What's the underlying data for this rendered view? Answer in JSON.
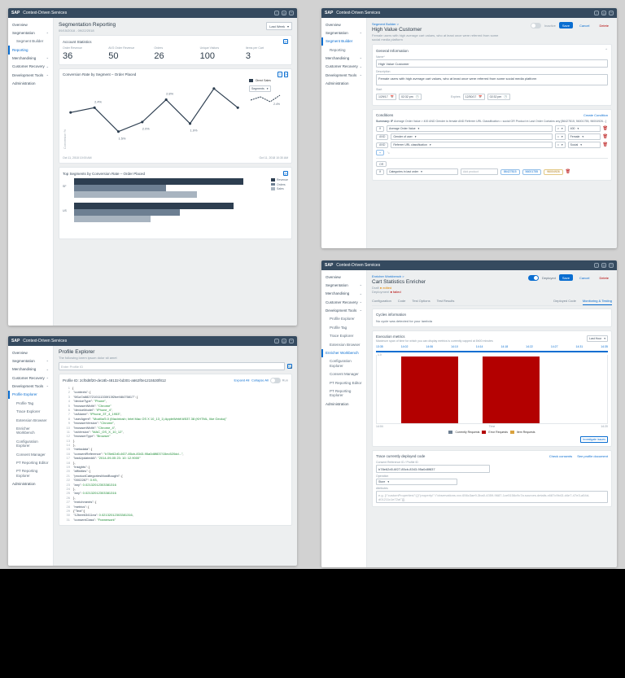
{
  "brand": "SAP",
  "app_name": "Context-Driven Services",
  "sidebar_common": {
    "overview": "Overview",
    "segmentation": "Segmentation",
    "segment_builder": "Segment Builder",
    "reporting": "Reporting",
    "merchandising": "Merchandising",
    "customer_recovery": "Customer Recovery",
    "development_tools": "Development Tools",
    "administration": "Administration",
    "profile_explorer": "Profile Explorer",
    "profile_tag": "Profile Tag",
    "trace_explorer": "Trace Explorer",
    "extension_browser": "Extension Browser",
    "enricher_workbench": "Enricher Workbench",
    "configuration_explorer": "Configuration Explorer",
    "consent_manager": "Consent Manager",
    "pt_reporting_editor": "PT Reporting Editor",
    "pt_reporting_explorer": "PT Reporting Explorer"
  },
  "panel1": {
    "title": "Segmentation Reporting",
    "date_range": "09/15/2018 - 09/22/2018",
    "range_label": "Last Week",
    "stats_card_title": "Account Statistics",
    "stats": [
      {
        "label": "Order Revenue",
        "value": "36"
      },
      {
        "label": "AVG Order Revenue",
        "value": "50"
      },
      {
        "label": "Orders",
        "value": "26"
      },
      {
        "label": "Unique Visitors",
        "value": "100"
      },
      {
        "label": "Items per Cart",
        "value": "3"
      }
    ],
    "line_title": "Conversion Rate by Segment – Order Placed",
    "line_legend_a": "Direct Sales",
    "line_control": "Segments",
    "bar_title": "Top Segments by Conversion Rate – Order Placed",
    "bar_legend": [
      "Revenue",
      "Orders",
      "Sales"
    ],
    "foot_l": "Oct 11, 2018 10:00 AM",
    "foot_r": "Oct 11, 2018 10:30 AM",
    "chart_data": {
      "line": {
        "type": "line",
        "x": [
          1,
          2,
          3,
          4,
          5,
          6,
          7,
          8
        ],
        "values": [
          2.2,
          2.4,
          1.5,
          2.0,
          2.8,
          1.9,
          3.0,
          2.4
        ],
        "labels_shown": [
          "2.8%",
          "2.4%",
          "1.5%",
          "2.0%",
          "2.8%",
          "1.9%",
          "3.0%",
          "2.4%"
        ],
        "direct_sales": "2.4%",
        "ylabel": "Conversion %"
      },
      "bars": {
        "type": "bar",
        "categories": [
          "SF",
          "US"
        ],
        "series": [
          {
            "name": "Revenue",
            "values": [
              55,
              52
            ]
          },
          {
            "name": "Orders",
            "values": [
              30,
              35
            ]
          },
          {
            "name": "Sales",
            "values": [
              40,
              25
            ]
          }
        ],
        "inner_labels": [
          "55",
          "30",
          "40",
          "52",
          "35",
          "25"
        ]
      }
    }
  },
  "panel2": {
    "crumb": "Segment Builder >",
    "title": "High Value Customer",
    "subtitle": "Female users with high average cart values, who at least once were referred from some social media platform",
    "inactive": "Inactive",
    "save": "Save",
    "cancel": "Cancel",
    "delete": "Delete",
    "gen_info": "General Information",
    "name_lab": "Name*",
    "name_val": "High Value Customer",
    "desc_lab": "Description",
    "desc_val": "Female users with high average cart values, who at least once were referred from some social media platform",
    "start_lab": "Start",
    "start_date": "1/29/17",
    "start_time": "02:32 pm",
    "expire_lab": "Expires",
    "expire_date": "12/30/17",
    "expire_time": "02:32 pm",
    "conditions": "Conditions",
    "create_cond": "Create Condition",
    "summary_pref": "Summary: IF",
    "summary_text": "Average Order Value > 400 AND Gender is female AND Referrer URL Classification = social    OR    Product in Last Order Contains any [86427815, 56001755, 96004926...]",
    "op_if": "If",
    "op_and": "AND",
    "op_or": "OR",
    "r1_a": "Average Order Value",
    "r1_op": ">",
    "r1_v": "400",
    "r2_a": "Gender of user",
    "r2_op": "=",
    "r2_v": "Female",
    "r3_a": "Referrer URL classification",
    "r3_op": "=",
    "r3_v": "Social",
    "r4_arrow": "↘",
    "cat_lab": "Categories in last order",
    "add_product": "Add product",
    "pill_a": "86427815",
    "pill_b": "56001755",
    "pill_c": "96004926"
  },
  "panel3": {
    "crumb": "Enricher Workbench >",
    "title": "Cart Statistics Enricher",
    "draft": "Draft",
    "deployment": "Deployment",
    "draft_stat": "● edited",
    "deploy_stat": "● failed",
    "deployed": "Deployed",
    "save": "Save",
    "cancel": "Cancel",
    "delete": "Delete",
    "tabs": [
      "Configuration",
      "Code",
      "Test Options",
      "Test Results"
    ],
    "tabs_r": [
      "Deployed Code",
      "Monitoring & Testing"
    ],
    "cycles_title": "Cycles information",
    "cycles_body": "No cycle was detected for your lambda",
    "exec_title": "Execution metrics",
    "exec_sub": "Maximum span of time for which you can display metrics is currently capped at 8h00 minutes",
    "range": "Last Hour",
    "times": [
      "13:35",
      "14:02",
      "14:06",
      "14:10",
      "14:14",
      "14:18",
      "14:22",
      "14:27",
      "14:31",
      "14:35"
    ],
    "ymax": "1.0",
    "half_labels": [
      "14:04",
      "14:20"
    ],
    "legend": [
      "Currently Requests",
      "Error Requests",
      "Item Requests"
    ],
    "investigate": "Investigate issues",
    "trace_title": "Trace currently deployed code",
    "trace_r1": "Check consents",
    "trace_r2": "See profile document",
    "consent_lab": "Consent Reference ID / Profile ID",
    "consent_val": "b78e62d0-6f27-85cb-8343-95a0d8f837",
    "op_lab": "Operation",
    "op_val": "Store",
    "attr_lab": "Attributes",
    "attr_ph": "e.g. {\\\"customProperties\\\":[{\\\"property\\\":\\\"observations.xxx.656c3ae9-3ba0-4359-9687-1ce5156c9c7a.sources.details.x687c9b43-d4e7-47e3-a54d-d01211c1e72a\\\"}]}",
    "chart_data": {
      "type": "bar",
      "x": [
        "13:35",
        "14:02",
        "14:06",
        "14:10",
        "14:14",
        "14:18",
        "14:22",
        "14:27",
        "14:31",
        "14:35"
      ],
      "series": [
        {
          "name": "Error Requests",
          "values": [
            0,
            0,
            1,
            1,
            1,
            0,
            1,
            1,
            1,
            0
          ]
        }
      ],
      "ylim": [
        0,
        1.0
      ]
    }
  },
  "panel4": {
    "title": "Profile Explorer",
    "subtitle": "The following lorem ipsum dolor sit amet",
    "search_ph": "Enter Profile ID",
    "profile_id": "Profile ID: 2cf0d8f20-de18b-48132-bd301-a662f0e1215530f812",
    "expand": "Expand All",
    "collapse": "Collapse All",
    "run": "Run",
    "code_lines": [
      "{",
      "  \"contexts\": {",
      "    \"6f1a7a8827210111330f13f2bef48475817\": {",
      "      \"deviceType\": \"Phone\",",
      "      \"browserWidth\": \"Chrome\"",
      "      \"deviceModel\": \"iPhone_4\",",
      "      \"osName\": \"iPhone_3T_4_1953\",",
      "      \"userAgent\": \"Mozilla/5.0 (Macintosh; Intel Mac OS X 10_13_1) AppleWebKit/537.38 (KHTML, like Gecko)\"",
      "      \"browserVersion\": \"Chrome\",",
      "      \"browserWidth\": \"Chrome_4\",",
      "      \"osVersion\": \"MAC_OS_X_10_12\",",
      "      \"browserType\": \"Browser\"",
      "    }",
      "  },",
      "  \"metadata\": {",
      "    \"consentReference\": \"b78e62d0-6f27-85cb-8343-95a0d8f837/15ec520dd...\",",
      "    \"lastUpdatedAt\": \"2014-09-05 23:10:12.9000\"",
      "  },",
      "  \"insights\": {",
      "    \"affinities\": {",
      "      \"productCategoriesMostBought\": {",
      "        \"0002287\": 0.93,",
      "        \"any\": 0.02132012303381316",
      "      },",
      "      \"any\": 0.02132012303381316",
      "    },",
      "    \"enrichments\": {",
      "      \"metrics\": {",
      "        {\"Text\":[",
      "          \"12bee63411ea\": 0.02132012303381316,",
      "          \"consentClass\": \"Framework\""
    ]
  }
}
